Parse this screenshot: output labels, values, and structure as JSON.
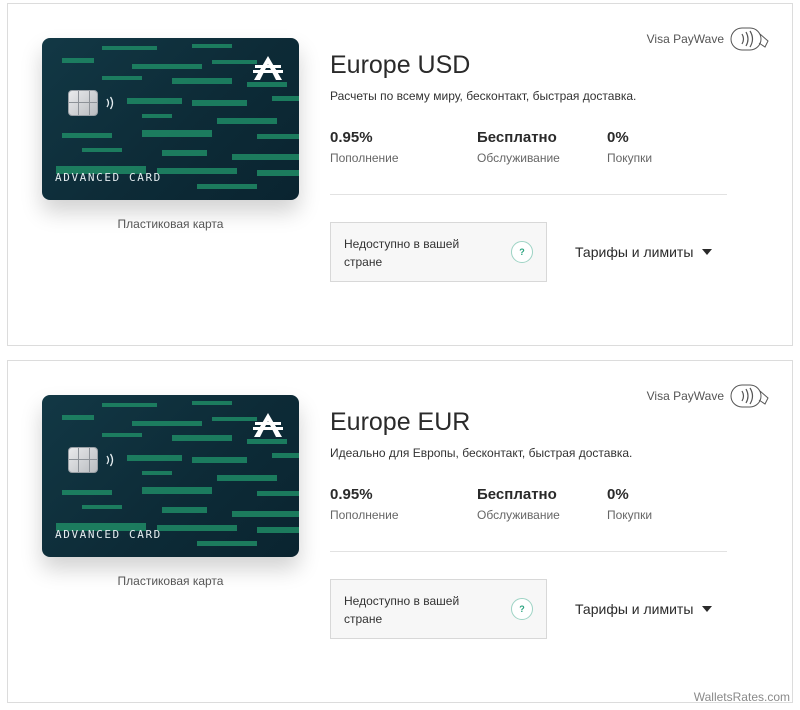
{
  "cards": [
    {
      "title": "Europe USD",
      "description": "Расчеты по всему миру, бесконтакт, быстрая доставка.",
      "paywave_label": "Visa PayWave",
      "card_face_text": "ADVANCED CARD",
      "card_caption": "Пластиковая карта",
      "stats": [
        {
          "value": "0.95%",
          "label": "Пополнение"
        },
        {
          "value": "Бесплатно",
          "label": "Обслуживание"
        },
        {
          "value": "0%",
          "label": "Покупки"
        }
      ],
      "unavailable_text": "Недоступно в вашей стране",
      "help_glyph": "?",
      "tariffs_label": "Тарифы и лимиты"
    },
    {
      "title": "Europe EUR",
      "description": "Идеально для Европы, бесконтакт, быстрая доставка.",
      "paywave_label": "Visa PayWave",
      "card_face_text": "ADVANCED CARD",
      "card_caption": "Пластиковая карта",
      "stats": [
        {
          "value": "0.95%",
          "label": "Пополнение"
        },
        {
          "value": "Бесплатно",
          "label": "Обслуживание"
        },
        {
          "value": "0%",
          "label": "Покупки"
        }
      ],
      "unavailable_text": "Недоступно в вашей стране",
      "help_glyph": "?",
      "tariffs_label": "Тарифы и лимиты"
    }
  ],
  "watermark": "WalletsRates.com",
  "colors": {
    "card_background": "#0d2b37",
    "card_stripes": "#1f8a65",
    "help_accent": "#2aa37f"
  },
  "icons": [
    "contactless-paywave-icon",
    "card-chip-icon",
    "nfc-wave-icon",
    "advcash-logo-icon",
    "question-icon",
    "caret-down-icon"
  ]
}
